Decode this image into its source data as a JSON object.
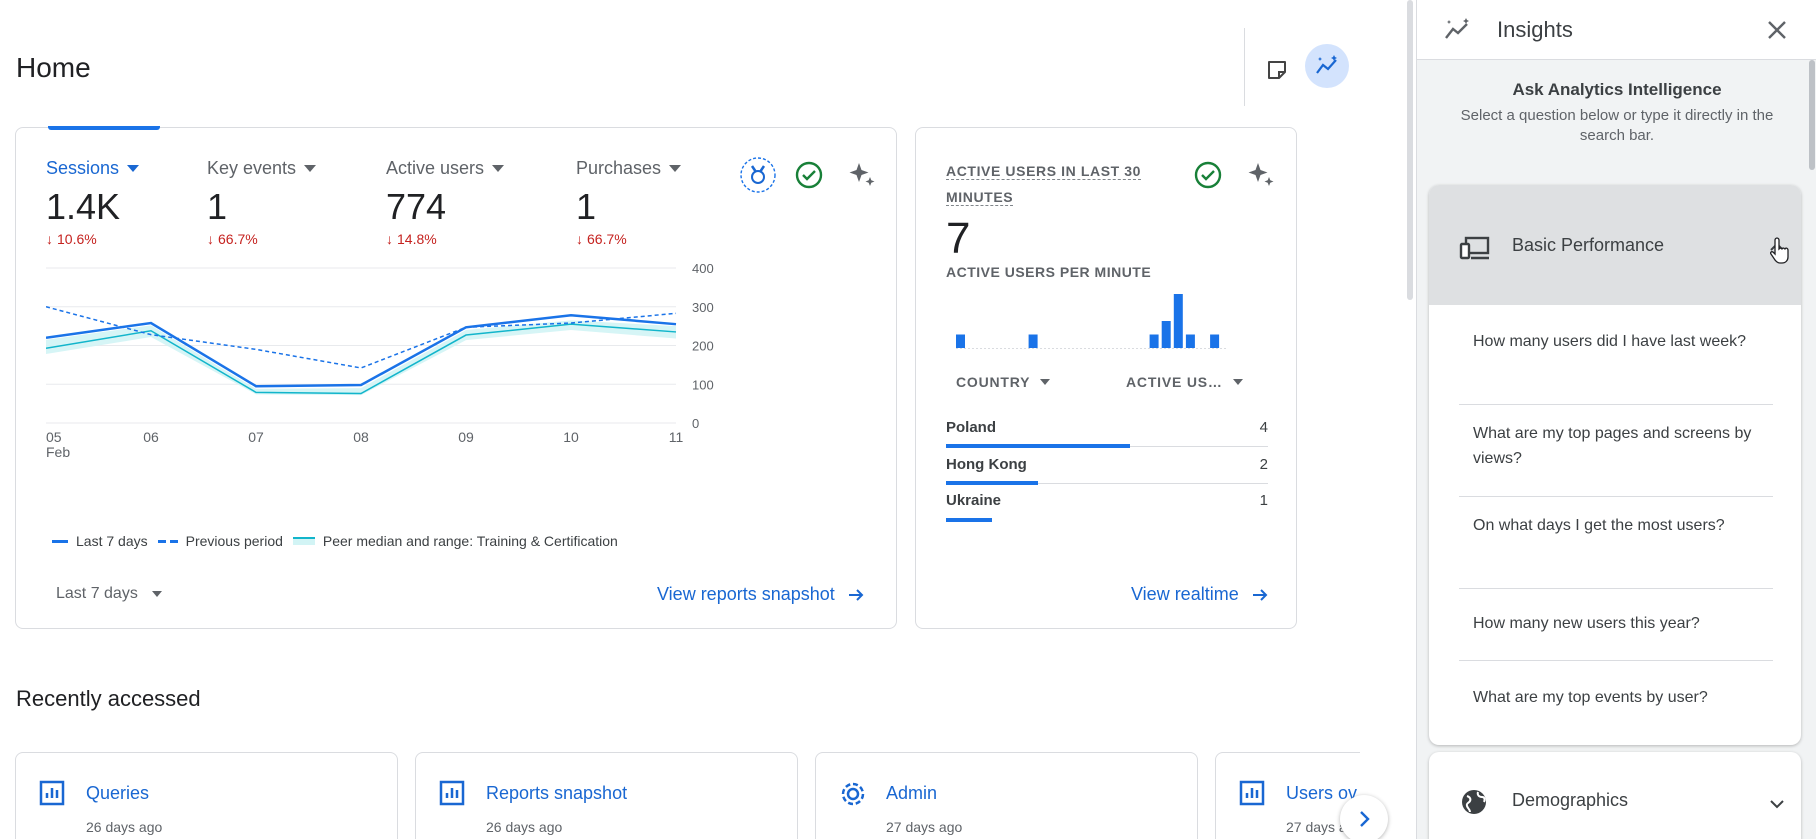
{
  "page": {
    "title": "Home"
  },
  "toolbar": {
    "notes_icon": "notes-icon",
    "insights_icon": "insights-sparkline-icon"
  },
  "overview": {
    "metrics": [
      {
        "label": "Sessions",
        "value": "1.4K",
        "change": "10.6%"
      },
      {
        "label": "Key events",
        "value": "1",
        "change": "66.7%"
      },
      {
        "label": "Active users",
        "value": "774",
        "change": "14.8%"
      },
      {
        "label": "Purchases",
        "value": "1",
        "change": "66.7%"
      }
    ],
    "legend": {
      "current": "Last 7 days",
      "previous": "Previous period",
      "peer": "Peer median and range: Training & Certification"
    },
    "date_range": "Last 7 days",
    "link": "View reports snapshot"
  },
  "chart_data": {
    "type": "line",
    "x": [
      "05",
      "06",
      "07",
      "08",
      "09",
      "10",
      "11"
    ],
    "x_sublabel": "Feb",
    "ylim": [
      0,
      400
    ],
    "yticks": [
      0,
      100,
      200,
      300,
      400
    ],
    "grid": true,
    "series": [
      {
        "name": "Last 7 days",
        "style": "solid",
        "values": [
          220,
          258,
          95,
          98,
          247,
          278,
          255
        ]
      },
      {
        "name": "Previous period",
        "style": "dashed",
        "values": [
          300,
          228,
          190,
          142,
          247,
          258,
          283
        ]
      },
      {
        "name": "Peer median and range: Training & Certification",
        "style": "band",
        "values": [
          193,
          238,
          79,
          76,
          227,
          255,
          235
        ],
        "low": [
          178,
          222,
          74,
          72,
          214,
          240,
          218
        ],
        "high": [
          215,
          252,
          88,
          90,
          240,
          265,
          250
        ]
      }
    ]
  },
  "realtime": {
    "title": "ACTIVE USERS IN LAST 30 MINUTES",
    "value": "7",
    "subtitle": "ACTIVE USERS PER MINUTE",
    "per_minute": [
      1,
      0,
      0,
      0,
      0,
      0,
      1,
      0,
      0,
      0,
      0,
      0,
      0,
      0,
      0,
      0,
      1,
      2,
      4,
      1,
      0,
      1
    ],
    "col_country": "COUNTRY",
    "col_users": "ACTIVE US…",
    "rows": [
      {
        "country": "Poland",
        "count": "4",
        "share": 0.5714
      },
      {
        "country": "Hong Kong",
        "count": "2",
        "share": 0.2857
      },
      {
        "country": "Ukraine",
        "count": "1",
        "share": 0.1429
      }
    ],
    "link": "View realtime"
  },
  "recent": {
    "title": "Recently accessed",
    "items": [
      {
        "title": "Queries",
        "date": "26 days ago",
        "icon": "report-icon"
      },
      {
        "title": "Reports snapshot",
        "date": "26 days ago",
        "icon": "report-icon"
      },
      {
        "title": "Admin",
        "date": "27 days ago",
        "icon": "gear-icon"
      },
      {
        "title": "Users ov",
        "date": "27 days a",
        "icon": "report-icon"
      }
    ]
  },
  "insights": {
    "title": "Insights",
    "ask_title": "Ask Analytics Intelligence",
    "ask_text": "Select a question below or type it directly in the search bar.",
    "sections": [
      {
        "title": "Basic Performance",
        "questions": [
          "How many users did I have last week?",
          "What are my top pages and screens by views?",
          "On what days I get the most users?",
          "How many new users this year?",
          "What are my top events by user?"
        ]
      },
      {
        "title": "Demographics"
      }
    ]
  },
  "colors": {
    "primary": "#1a73e8",
    "link": "#1967d2",
    "negative": "#c5221f",
    "peer": "#12b5cb",
    "peer_band": "#d2f4f5"
  }
}
